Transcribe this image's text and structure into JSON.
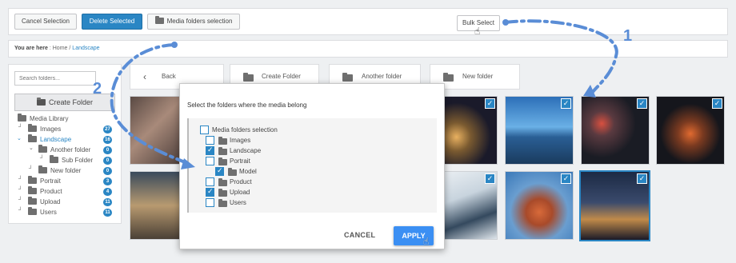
{
  "toolbar": {
    "cancel_selection": "Cancel Selection",
    "delete_selected": "Delete Selected",
    "media_folders_selection": "Media folders selection",
    "bulk_select": "Bulk Select"
  },
  "breadcrumb": {
    "prefix": "You are here",
    "separator": ":",
    "home": "Home",
    "slash": "/",
    "current": "Landscape"
  },
  "sidebar": {
    "search_placeholder": "Search folders...",
    "create_folder": "Create Folder",
    "tree": [
      {
        "label": "Media Library",
        "count": ""
      },
      {
        "label": "Images",
        "count": "27"
      },
      {
        "label": "Landscape",
        "count": "16"
      },
      {
        "label": "Another folder",
        "count": "0"
      },
      {
        "label": "Sub Folder",
        "count": "0"
      },
      {
        "label": "New folder",
        "count": "0"
      },
      {
        "label": "Portrait",
        "count": "3"
      },
      {
        "label": "Product",
        "count": "4"
      },
      {
        "label": "Upload",
        "count": "11"
      },
      {
        "label": "Users",
        "count": "11"
      }
    ]
  },
  "nav": {
    "back": "Back",
    "create_folder": "Create Folder",
    "another_folder": "Another folder",
    "new_folder": "New folder"
  },
  "modal": {
    "title": "Select the folders where the media belong",
    "options": [
      {
        "label": "Media folders selection",
        "checked": false
      },
      {
        "label": "Images",
        "checked": false
      },
      {
        "label": "Landscape",
        "checked": true
      },
      {
        "label": "Portrait",
        "checked": false
      },
      {
        "label": "Model",
        "checked": true
      },
      {
        "label": "Product",
        "checked": false
      },
      {
        "label": "Upload",
        "checked": true
      },
      {
        "label": "Users",
        "checked": false
      }
    ],
    "cancel": "CANCEL",
    "apply": "APPLY"
  },
  "annotations": {
    "step1": "1",
    "step2": "2"
  },
  "colors": {
    "accent": "#2a86c4",
    "annotation": "#5a8dd6",
    "apply": "#3b8ff3"
  }
}
